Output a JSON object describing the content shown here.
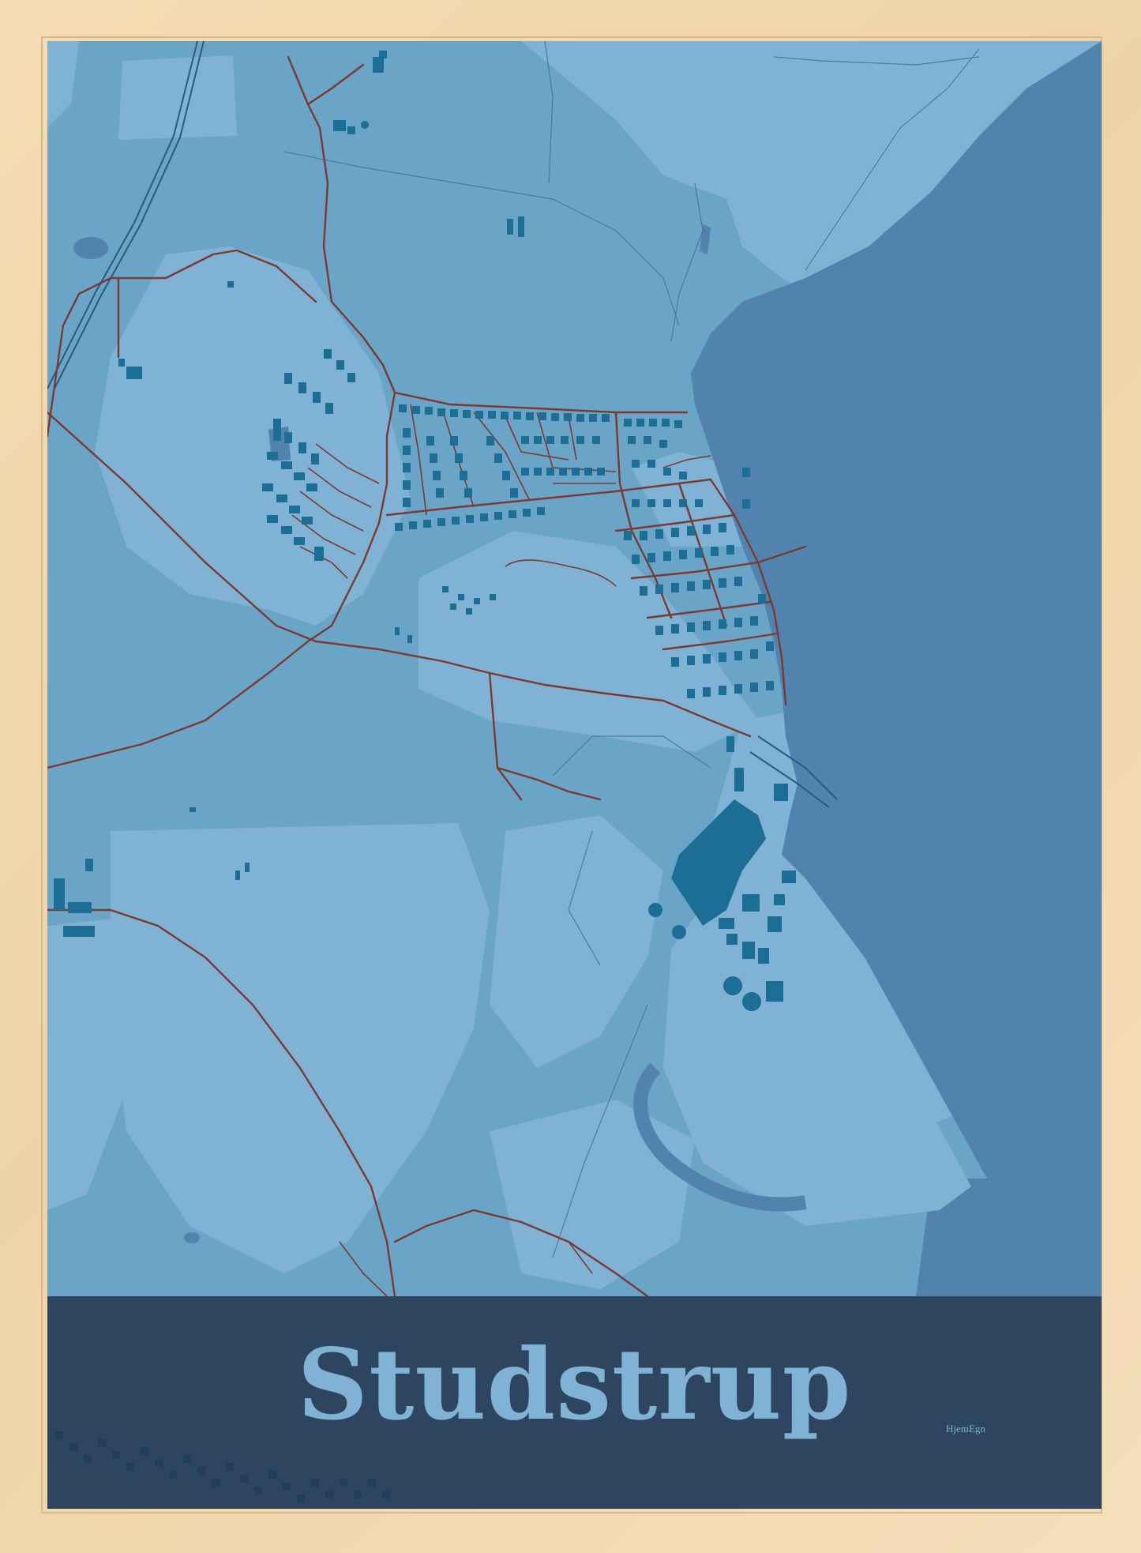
{
  "poster": {
    "title": "Studstrup",
    "brand": "HjemEgn"
  },
  "colors": {
    "frame": "#efd3a8",
    "sea": "#5183ae",
    "land_light": "#7fb2d4",
    "land_mid": "#6aa4c6",
    "roads": "#7a3a32",
    "buildings": "#1d6e97",
    "title_band": "#243850",
    "title_text": "#7fb2d4"
  }
}
